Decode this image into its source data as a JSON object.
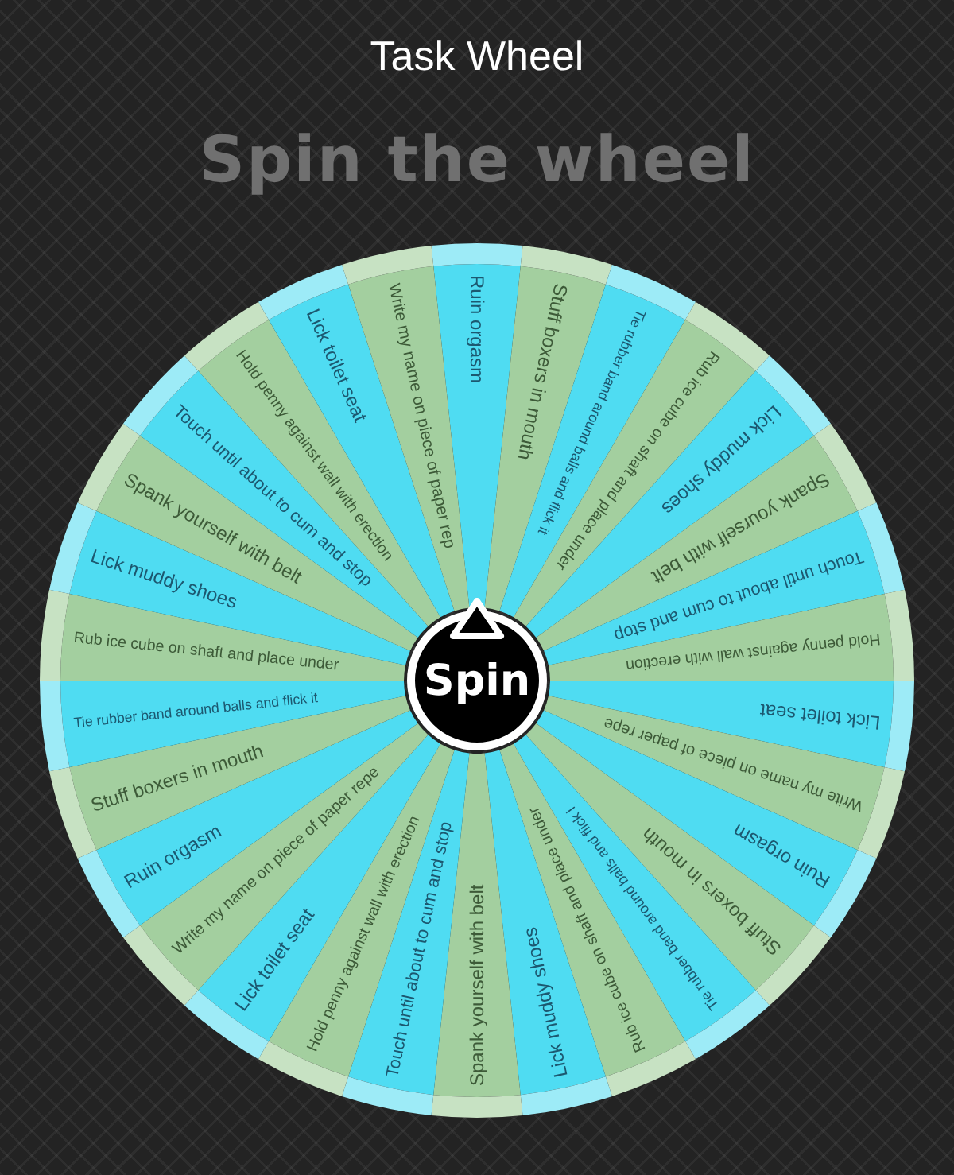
{
  "window": {
    "title": "Task Wheel"
  },
  "heading": "Spin the wheel",
  "wheel": {
    "spin_button": "Spin",
    "segments": [
      {
        "label": "Ruin orgasm",
        "color": "#4fdcf2"
      },
      {
        "label": "Stuff boxers in mouth",
        "color": "#a3cf9f"
      },
      {
        "label": "Tie rubber band around balls and flick it",
        "color": "#4fdcf2"
      },
      {
        "label": "Rub ice cube on shaft and place under",
        "color": "#a3cf9f"
      },
      {
        "label": "Lick muddy shoes",
        "color": "#4fdcf2"
      },
      {
        "label": "Spank yourself with belt",
        "color": "#a3cf9f"
      },
      {
        "label": "Touch until about to cum and stop",
        "color": "#4fdcf2"
      },
      {
        "label": "Hold penny against wall with erection",
        "color": "#a3cf9f"
      },
      {
        "label": "Lick toilet seat",
        "color": "#4fdcf2"
      },
      {
        "label": "Write my name on piece of paper repe",
        "color": "#a3cf9f"
      },
      {
        "label": "Ruin orgasm",
        "color": "#4fdcf2"
      },
      {
        "label": "Stuff boxers in mouth",
        "color": "#a3cf9f"
      },
      {
        "label": "Tie rubber band around balls and flick i",
        "color": "#4fdcf2"
      },
      {
        "label": "Rub ice cube on shaft and place under",
        "color": "#a3cf9f"
      },
      {
        "label": "Lick muddy shoes",
        "color": "#4fdcf2"
      },
      {
        "label": "Spank yourself with belt",
        "color": "#a3cf9f"
      },
      {
        "label": "Touch until about to cum and stop",
        "color": "#4fdcf2"
      },
      {
        "label": "Hold penny against wall with erection",
        "color": "#a3cf9f"
      },
      {
        "label": "Lick toilet seat",
        "color": "#4fdcf2"
      },
      {
        "label": "Write my name on piece of paper repe",
        "color": "#a3cf9f"
      },
      {
        "label": "Ruin orgasm",
        "color": "#4fdcf2"
      },
      {
        "label": "Stuff boxers in mouth",
        "color": "#a3cf9f"
      },
      {
        "label": "Tie rubber band around balls and flick it",
        "color": "#4fdcf2"
      },
      {
        "label": "Rub ice cube on shaft and place under",
        "color": "#a3cf9f"
      },
      {
        "label": "Lick muddy shoes",
        "color": "#4fdcf2"
      },
      {
        "label": "Spank yourself with belt",
        "color": "#a3cf9f"
      },
      {
        "label": "Touch until about to cum and stop",
        "color": "#4fdcf2"
      },
      {
        "label": "Hold penny against wall with erection",
        "color": "#a3cf9f"
      },
      {
        "label": "Lick toilet seat",
        "color": "#4fdcf2"
      },
      {
        "label": "Write my name on piece of paper rep",
        "color": "#a3cf9f"
      }
    ]
  }
}
